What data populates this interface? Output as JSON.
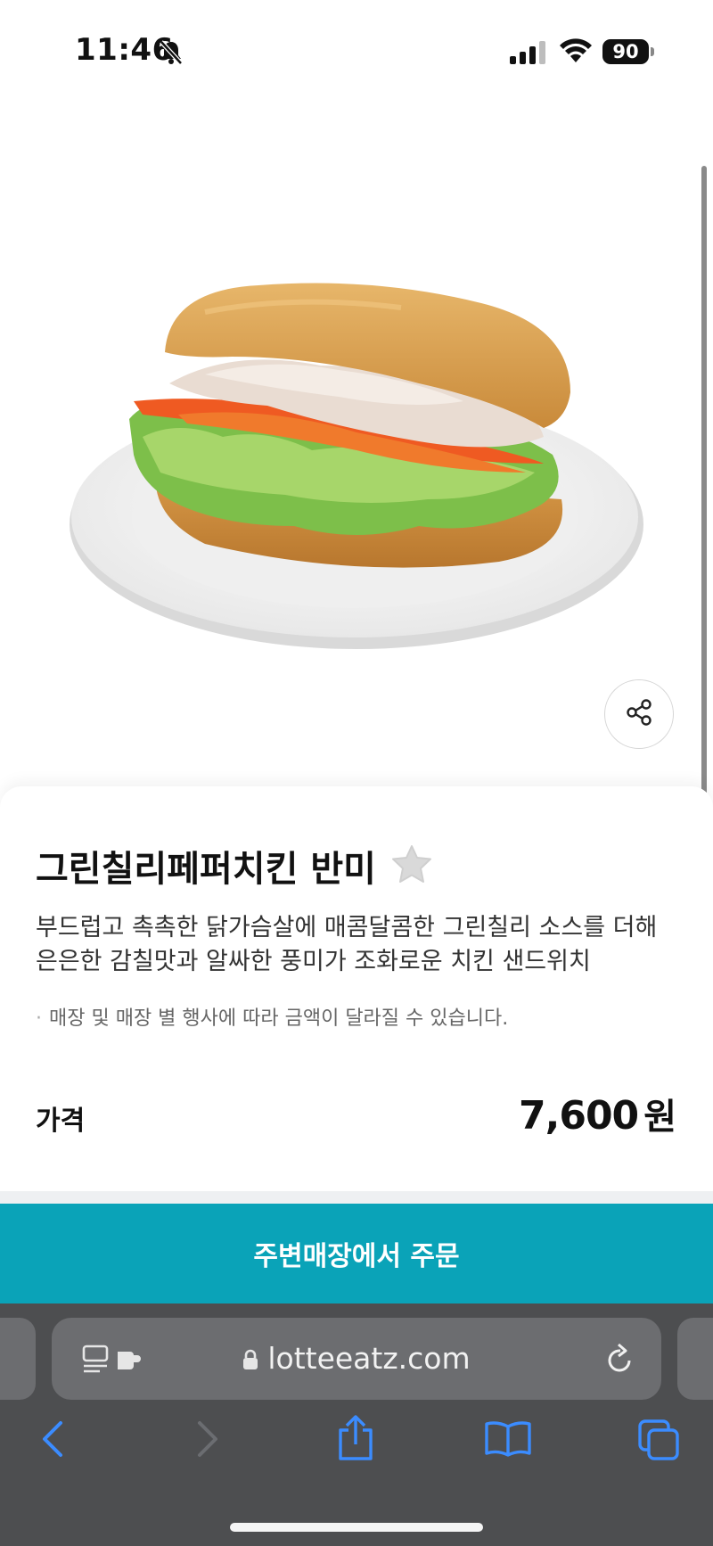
{
  "status_bar": {
    "time": "11:46",
    "battery": "90"
  },
  "product": {
    "name": "그린칠리페퍼치킨 반미",
    "description": "부드럽고 촉촉한 닭가슴살에 매콤달콤한 그린칠리 소스를 더해 은은한 감칠맛과 알싸한 풍미가 조화로운 치킨 샌드위치",
    "note": "매장 및 매장 별 행사에 따라 금액이 달라질 수 있습니다.",
    "price_label": "가격",
    "price_value": "7,600",
    "price_unit": "원"
  },
  "order_button": {
    "label": "주변매장에서 주문"
  },
  "browser": {
    "url": "lotteeatz.com"
  },
  "colors": {
    "accent": "#0aa3b8",
    "toolbar_blue": "#3b8cff",
    "browser_bg": "#4d4e50"
  },
  "icons": [
    "bell-slash-icon",
    "signal-icon",
    "wifi-icon",
    "battery-icon",
    "share-icon",
    "star-icon",
    "reader-icon",
    "extension-icon",
    "lock-icon",
    "reload-icon",
    "back-icon",
    "forward-icon",
    "share-sheet-icon",
    "bookmarks-icon",
    "tabs-icon"
  ]
}
